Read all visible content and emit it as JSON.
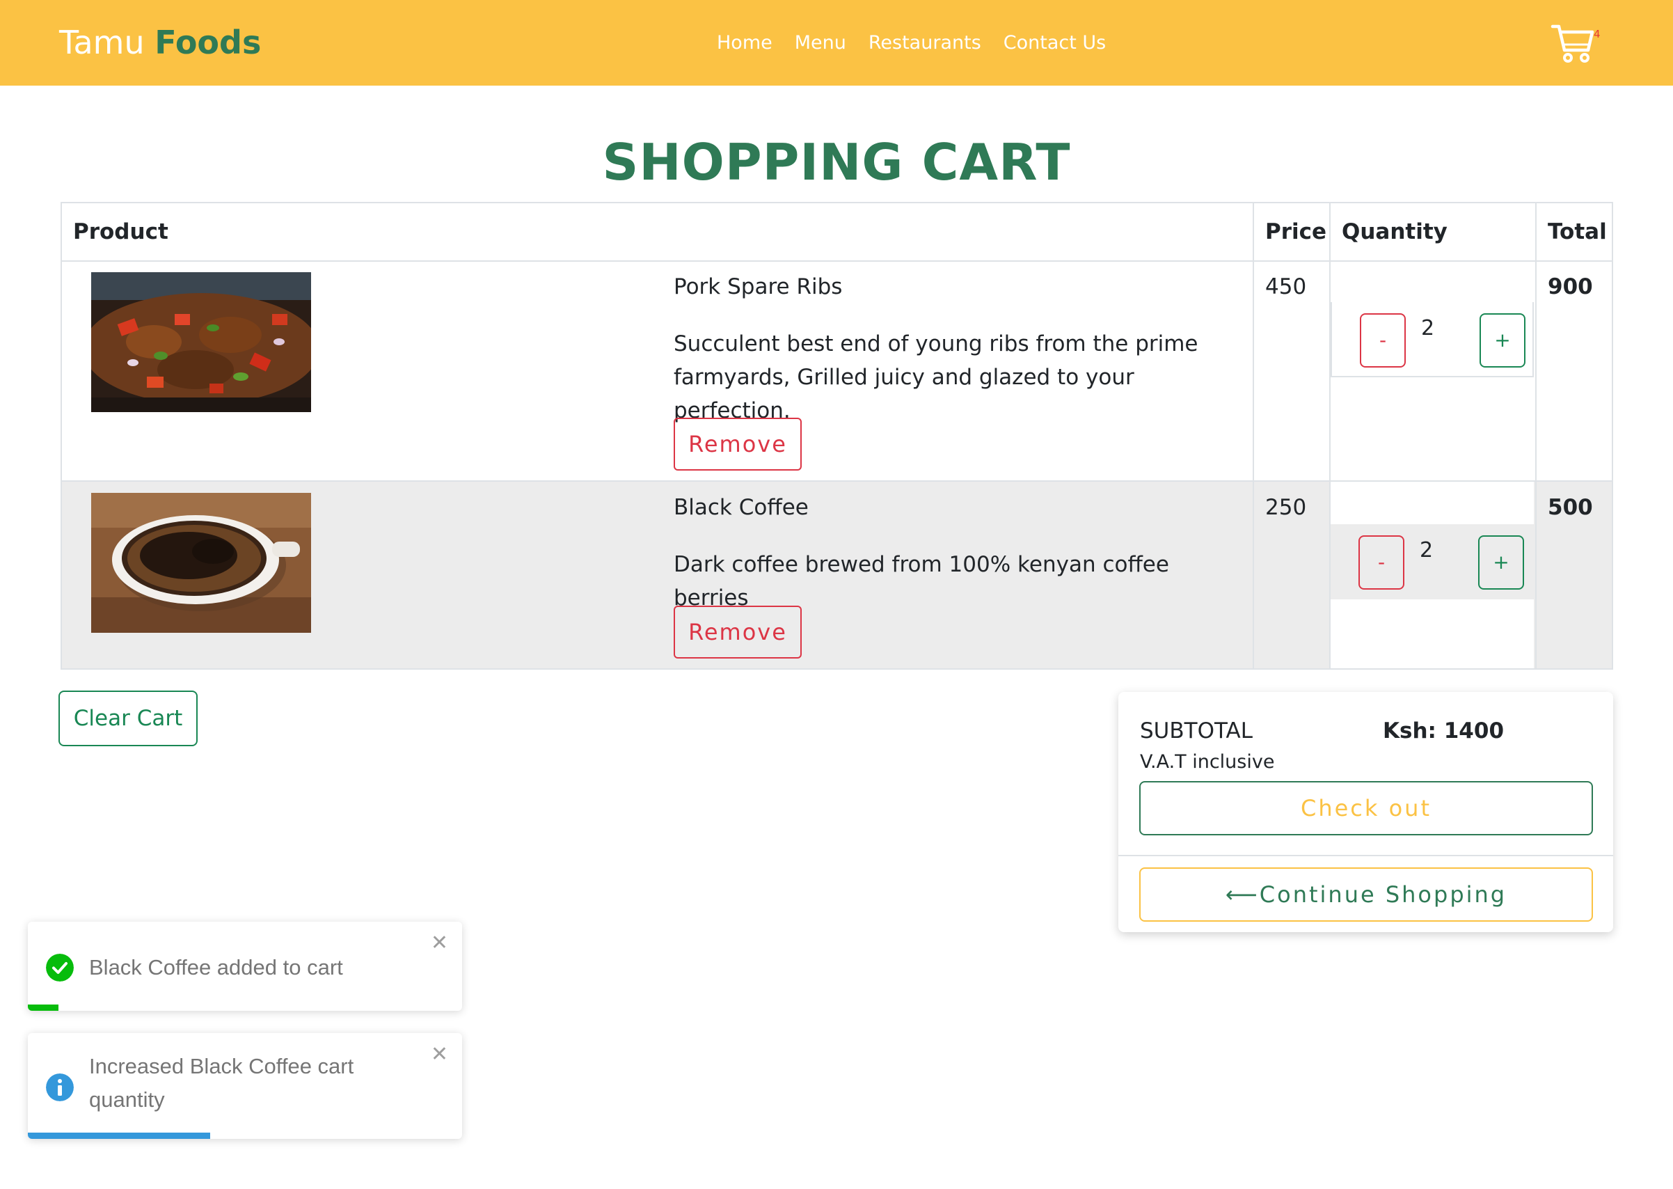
{
  "navbar": {
    "brand_first": "Tamu",
    "brand_second": "Foods",
    "links": [
      "Home",
      "Menu",
      "Restaurants",
      "Contact Us"
    ],
    "cart_count": "4",
    "bg_color": "#fbc244"
  },
  "page_title": "SHOPPING CART",
  "table": {
    "headers": [
      "Product",
      "Price",
      "Quantity",
      "Total"
    ],
    "rows": [
      {
        "name": "Pork Spare Ribs",
        "description": "Succulent best end of young ribs from the prime farmyards, Grilled juicy and glazed to your perfection.",
        "remove_label": "Remove",
        "price": "450",
        "quantity": "2",
        "decrease_label": "-",
        "increase_label": "+",
        "total": "900"
      },
      {
        "name": "Black Coffee",
        "description": "Dark coffee brewed from 100% kenyan coffee berries",
        "remove_label": "Remove",
        "price": "250",
        "quantity": "2",
        "decrease_label": "-",
        "increase_label": "+",
        "total": "500"
      }
    ]
  },
  "clear_cart_label": "Clear Cart",
  "summary": {
    "subtotal_label": "SUBTOTAL",
    "subtotal_value": "Ksh: 1400",
    "vat_note": "V.A.T inclusive",
    "checkout_label": "Check out",
    "continue_label": "⟵Continue Shopping"
  },
  "toasts": [
    {
      "type": "success",
      "icon": "check-circle-icon",
      "message": "Black Coffee added to cart",
      "close": "✕",
      "progress": 0.07,
      "color": "#07bc0c"
    },
    {
      "type": "info",
      "icon": "info-circle-icon",
      "message": "Increased Black Coffee cart quantity",
      "close": "✕",
      "progress": 0.42,
      "color": "#3498db"
    }
  ],
  "colors": {
    "brand_green": "#2f7a56",
    "brand_yellow": "#fbc244",
    "danger": "#dc3545",
    "success": "#198754"
  }
}
